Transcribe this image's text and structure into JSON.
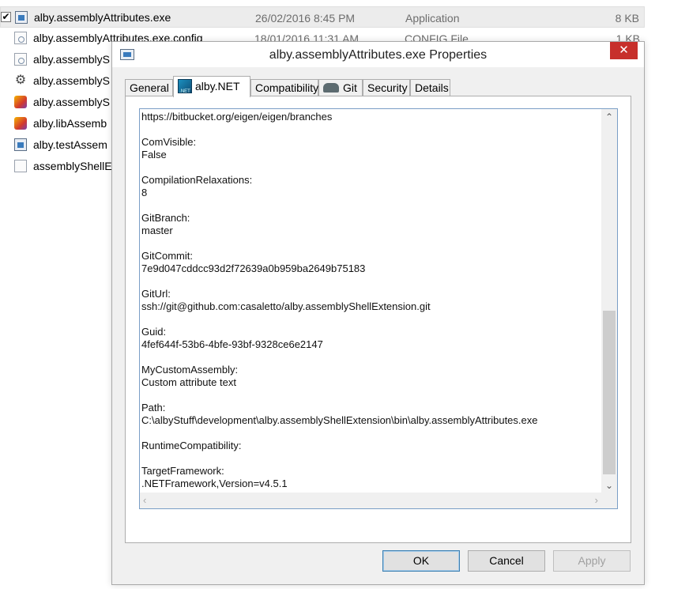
{
  "files": [
    {
      "name": "alby.assemblyAttributes.exe",
      "date": "26/02/2016 8:45 PM",
      "type": "Application",
      "size": "8 KB",
      "icon": "exe-icon",
      "checked": true
    },
    {
      "name": "alby.assemblyAttributes.exe.config",
      "date": "18/01/2016 11:31 AM",
      "type": "CONFIG File",
      "size": "1 KB",
      "icon": "config-file-icon"
    },
    {
      "name": "alby.assemblyS",
      "icon": "config-file-icon"
    },
    {
      "name": "alby.assemblyS",
      "icon": "gear-icon"
    },
    {
      "name": "alby.assemblyS",
      "icon": "library-icon"
    },
    {
      "name": "alby.libAssemb",
      "icon": "library-icon"
    },
    {
      "name": "alby.testAssem",
      "icon": "exe-icon"
    },
    {
      "name": "assemblyShellE",
      "icon": "document-icon"
    }
  ],
  "dialog": {
    "title": "alby.assemblyAttributes.exe Properties",
    "close_glyph": "✕",
    "tabs": [
      "General",
      "alby.NET",
      "Compatibility",
      "Git",
      "Security",
      "Details"
    ],
    "active_tab": "alby.NET",
    "content_lines": [
      "https://bitbucket.org/eigen/eigen/branches",
      "",
      "ComVisible:",
      "False",
      "",
      "CompilationRelaxations:",
      "8",
      "",
      "GitBranch:",
      "master",
      "",
      "GitCommit:",
      "7e9d047cddcc93d2f72639a0b959ba2649b75183",
      "",
      "GitUrl:",
      "ssh://git@github.com:casaletto/alby.assemblyShellExtension.git",
      "",
      "Guid:",
      "4fef644f-53b6-4bfe-93bf-9328ce6e2147",
      "",
      "MyCustomAssembly:",
      "Custom attribute text",
      "",
      "Path:",
      "C:\\albyStuff\\development\\alby.assemblyShellExtension\\bin\\alby.assemblyAttributes.exe",
      "",
      "RuntimeCompatibility:",
      "",
      "TargetFramework:",
      ".NETFramework,Version=v4.5.1"
    ],
    "buttons": {
      "ok": "OK",
      "cancel": "Cancel",
      "apply": "Apply"
    }
  },
  "scroll": {
    "up": "⌃",
    "down": "⌄",
    "left": "‹",
    "right": "›"
  }
}
